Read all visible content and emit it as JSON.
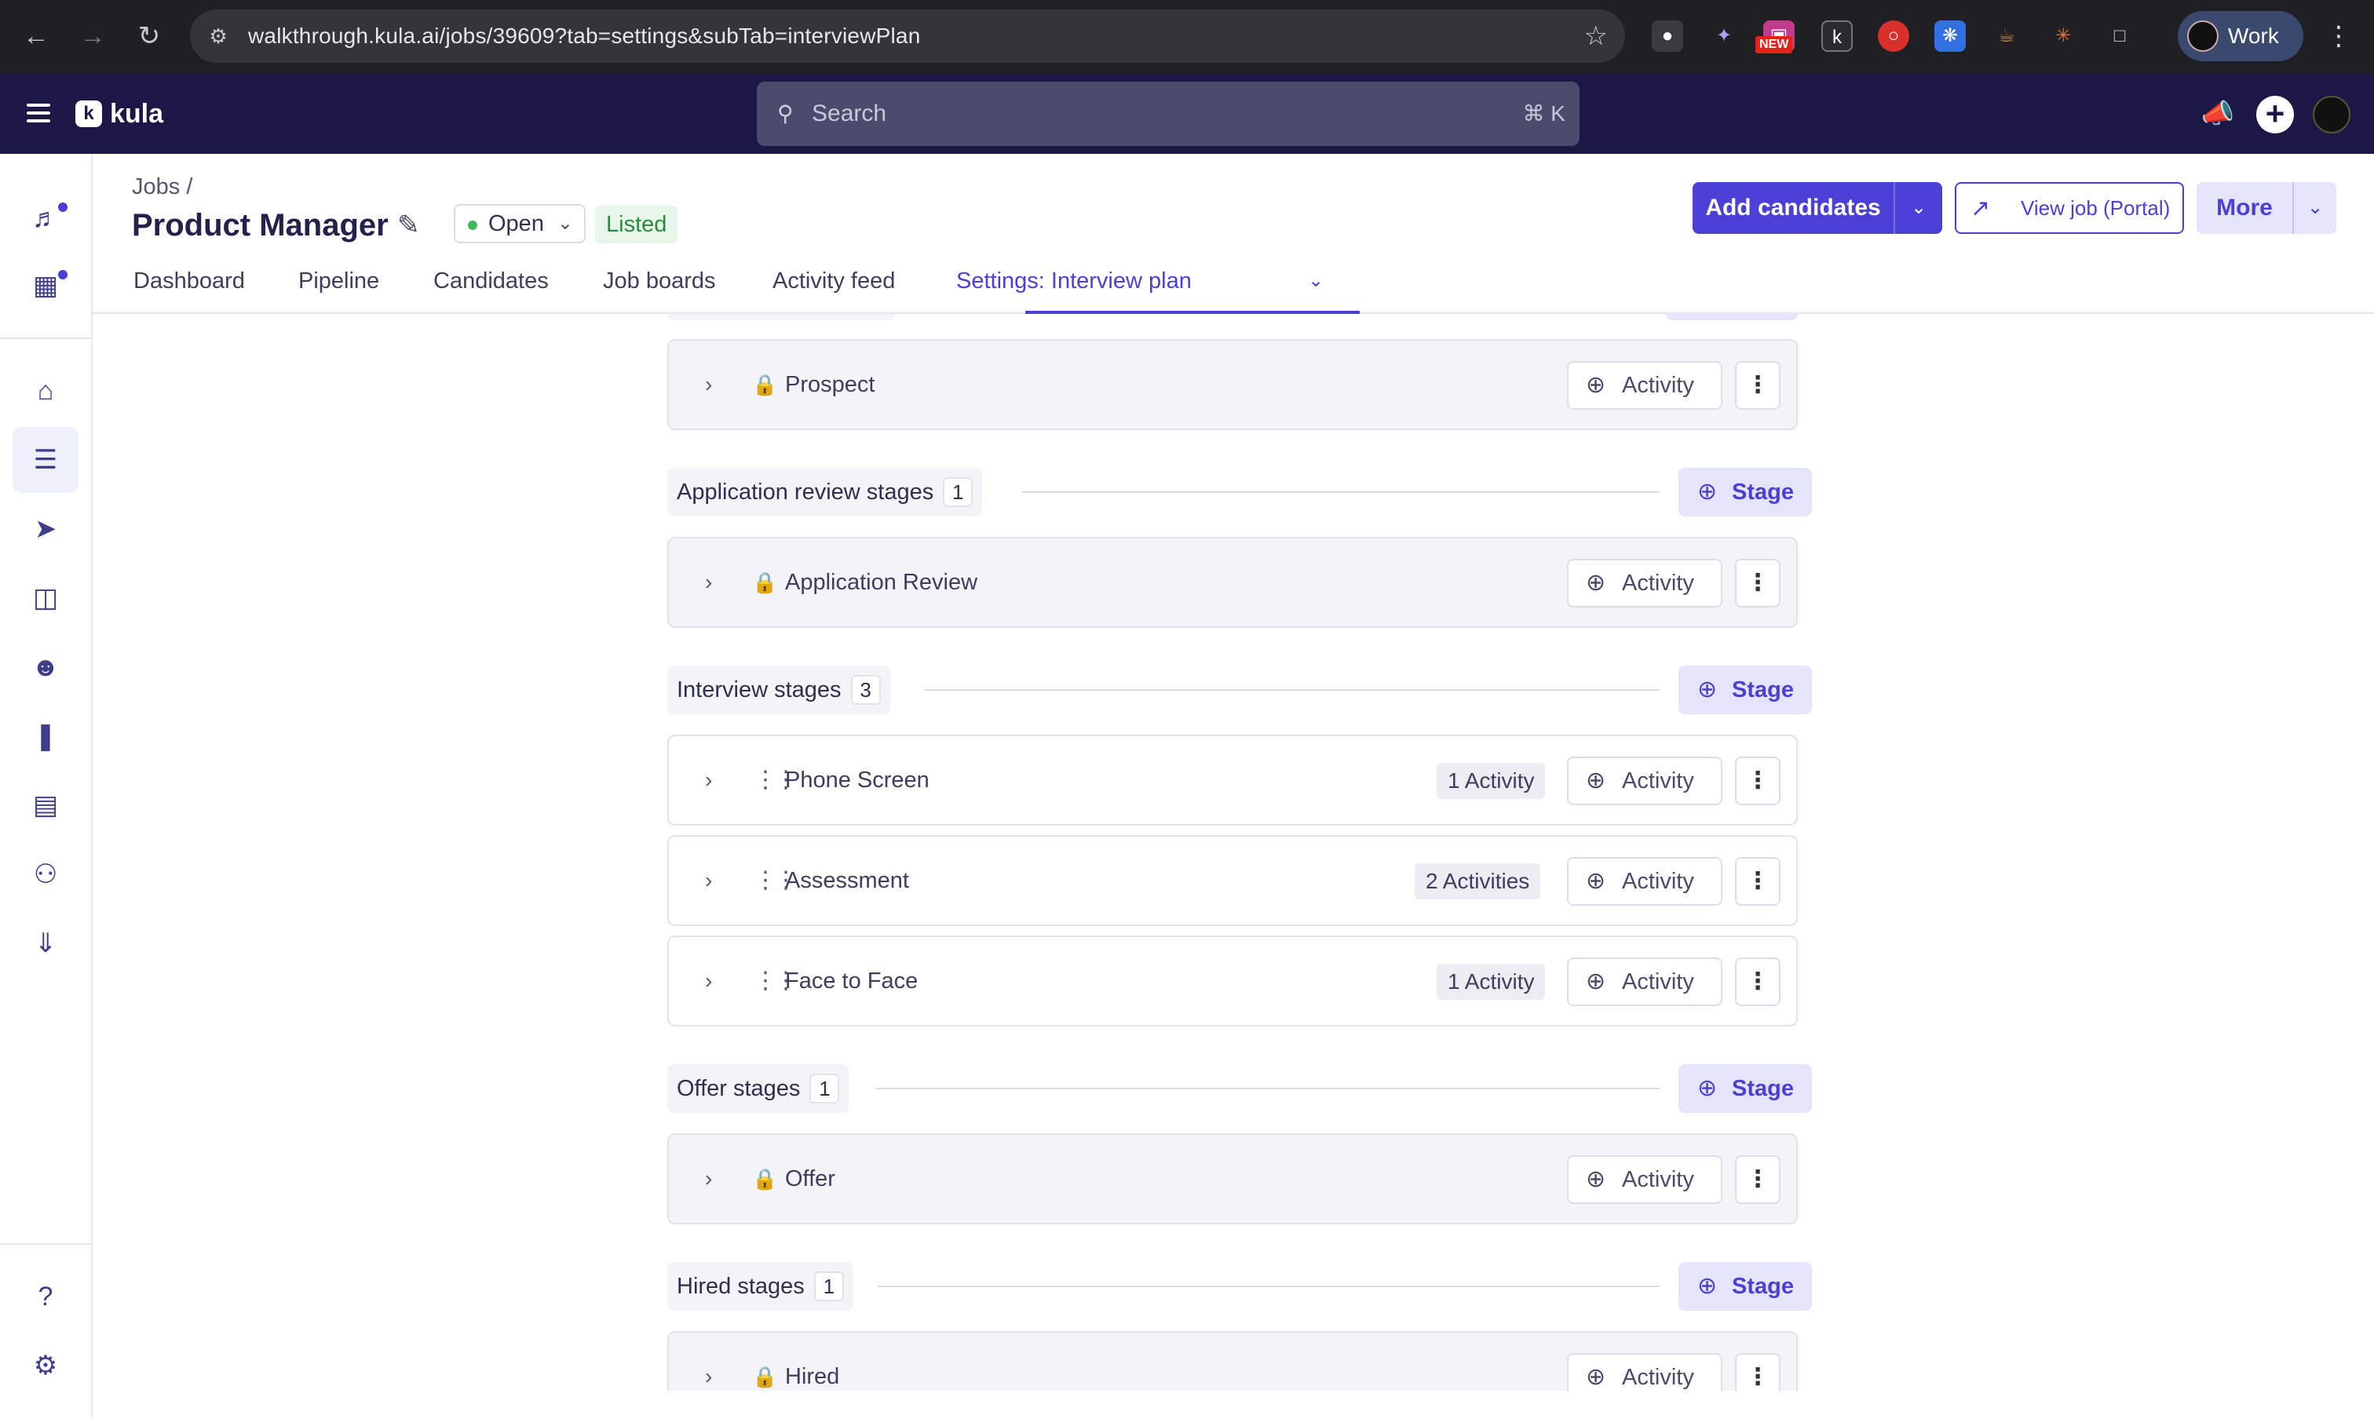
{
  "browser": {
    "url": "walkthrough.kula.ai/jobs/39609?tab=settings&subTab=interviewPlan",
    "profile_label": "Work",
    "new_badge": "NEW"
  },
  "app": {
    "logo_text": "kula",
    "search_placeholder": "Search",
    "search_shortcut": "⌘ K"
  },
  "page": {
    "breadcrumb": "Jobs /",
    "title": "Product Manager",
    "status": "Open",
    "listed_badge": "Listed",
    "add_candidates": "Add candidates",
    "view_job": "View job (Portal)",
    "more": "More"
  },
  "tabs": [
    "Dashboard",
    "Pipeline",
    "Candidates",
    "Job boards",
    "Activity feed",
    "Settings: Interview plan"
  ],
  "groups": [
    {
      "label": "Application review stages",
      "count": "1",
      "button": "Stage"
    },
    {
      "label": "Interview stages",
      "count": "3",
      "button": "Stage"
    },
    {
      "label": "Offer stages",
      "count": "1",
      "button": "Stage"
    },
    {
      "label": "Hired stages",
      "count": "1",
      "button": "Stage"
    }
  ],
  "stages": [
    {
      "title": "Prospect",
      "locked": true,
      "count": ""
    },
    {
      "title": "Application Review",
      "locked": true,
      "count": ""
    },
    {
      "title": "Phone Screen",
      "locked": false,
      "count": "1 Activity"
    },
    {
      "title": "Assessment",
      "locked": false,
      "count": "2 Activities"
    },
    {
      "title": "Face to Face",
      "locked": false,
      "count": "1 Activity"
    },
    {
      "title": "Offer",
      "locked": true,
      "count": ""
    },
    {
      "title": "Hired",
      "locked": true,
      "count": ""
    }
  ],
  "activity_button_label": "Activity",
  "colors": {
    "accent": "#4b3fd6",
    "header_bg": "#1b1845",
    "status_open": "#3dbb5a"
  }
}
